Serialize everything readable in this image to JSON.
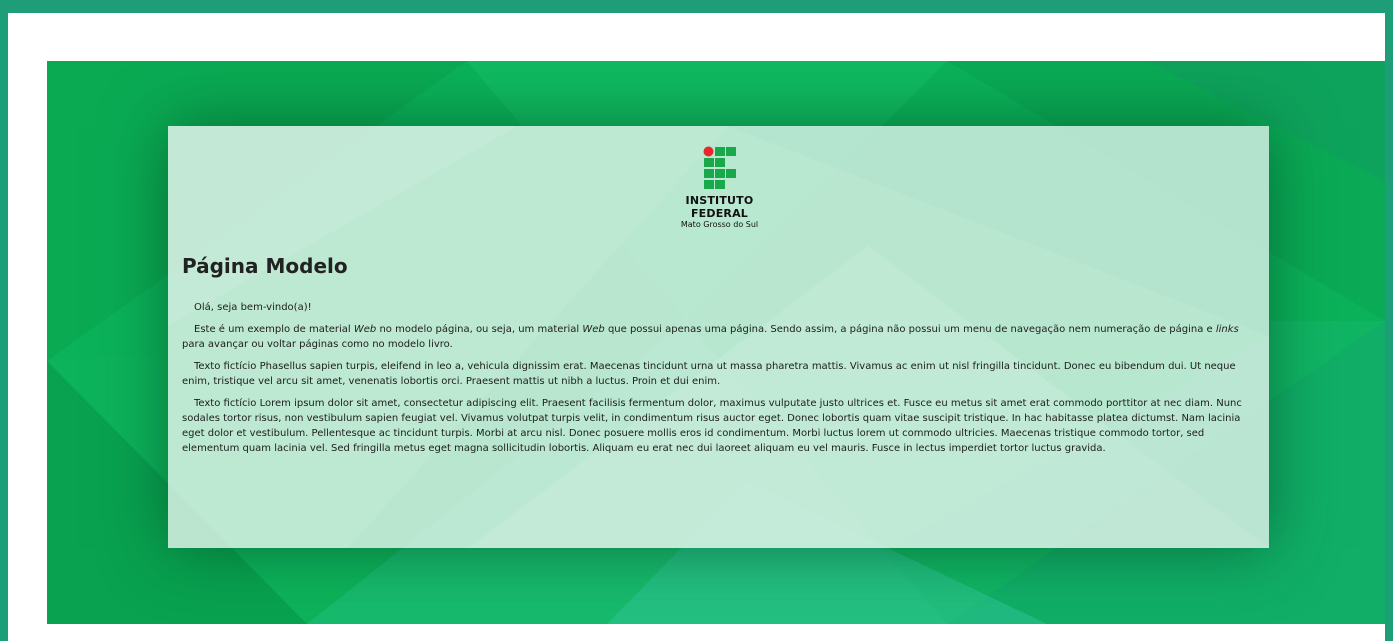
{
  "logo": {
    "line1": "INSTITUTO",
    "line2": "FEDERAL",
    "line3": "Mato Grosso do Sul"
  },
  "page": {
    "title": "Página Modelo"
  },
  "content": {
    "greeting": "Olá, seja bem-vindo(a)!",
    "p2": {
      "t1": "Este é um exemplo de material ",
      "e1": "Web",
      "t2": " no modelo página, ou seja, um material ",
      "e2": "Web",
      "t3": " que possui apenas uma página. Sendo assim, a página não possui um menu de navegação nem numeração de página e ",
      "e3": "links",
      "t4": " para avançar ou voltar páginas como no modelo livro."
    },
    "p3": "Texto fictício Phasellus sapien turpis, eleifend in leo a, vehicula dignissim erat. Maecenas tincidunt urna ut massa pharetra mattis. Vivamus ac enim ut nisl fringilla tincidunt. Donec eu bibendum dui. Ut neque enim, tristique vel arcu sit amet, venenatis lobortis orci. Praesent mattis ut nibh a luctus. Proin et dui enim.",
    "p4": "Texto fictício Lorem ipsum dolor sit amet, consectetur adipiscing elit. Praesent facilisis fermentum dolor, maximus vulputate justo ultrices et. Fusce eu metus sit amet erat commodo porttitor at nec diam. Nunc sodales tortor risus, non vestibulum sapien feugiat vel. Vivamus volutpat turpis velit, in condimentum risus auctor eget. Donec lobortis quam vitae suscipit tristique. In hac habitasse platea dictumst. Nam lacinia eget dolor et vestibulum. Pellentesque ac tincidunt turpis. Morbi at arcu nisl. Donec posuere mollis eros id condimentum. Morbi luctus lorem ut commodo ultricies. Maecenas tristique commodo tortor, sed elementum quam lacinia vel. Sed fringilla metus eget magna sollicitudin lobortis. Aliquam eu erat nec dui laoreet aliquam eu vel mauris. Fusce in lectus imperdiet tortor luctus gravida."
  },
  "colors": {
    "frame_border": "#1e9e78",
    "background_green": "#0db45a",
    "logo_green": "#19a84a",
    "logo_red": "#e8262e",
    "text": "#1d1d1d"
  }
}
